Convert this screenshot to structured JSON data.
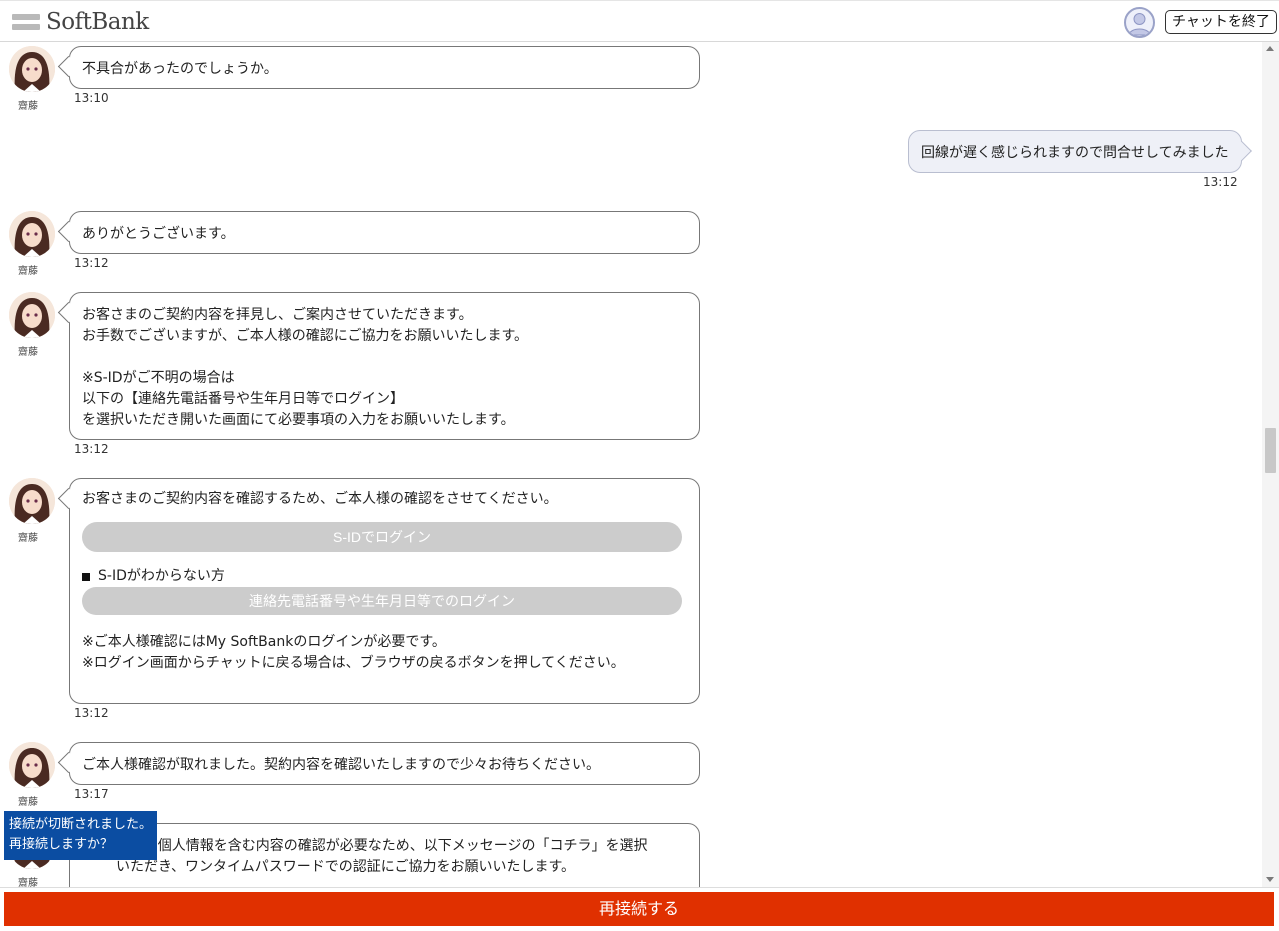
{
  "header": {
    "logo_text": "SoftBank",
    "end_chat_label": "チャットを終了"
  },
  "agent": {
    "name": "齋藤"
  },
  "messages": [
    {
      "from": "agent",
      "text": "不具合があったのでしょうか。",
      "time": "13:10"
    },
    {
      "from": "user",
      "text": "回線が遅く感じられますので問合せしてみました",
      "time": "13:12"
    },
    {
      "from": "agent",
      "text": "ありがとうございます。",
      "time": "13:12"
    },
    {
      "from": "agent",
      "text": "お客さまのご契約内容を拝見し、ご案内させていただきます。\nお手数でございますが、ご本人様の確認にご協力をお願いいたします。\n\n※S-IDがご不明の場合は\n以下の【連絡先電話番号や生年月日等でログイン】\nを選択いただき開いた画面にて必要事項の入力をお願いいたします。",
      "time": "13:12"
    },
    {
      "from": "agent",
      "intro": "お客さまのご契約内容を確認するため、ご本人様の確認をさせてください。",
      "sid_login_label": "S-IDでログイン",
      "sid_unknown_label": "S-IDがわからない方",
      "alt_login_label": "連絡先電話番号や生年月日等でのログイン",
      "note": "※ご本人様確認にはMy SoftBankのログインが必要です。\n※ログイン画面からチャットに戻る場合は、ブラウザの戻るボタンを押してください。",
      "time": "13:12"
    },
    {
      "from": "agent",
      "text": "ご本人様確認が取れました。契約内容を確認いたしますので少々お待ちください。",
      "time": "13:17"
    },
    {
      "from": "agent",
      "text": "すが、個人情報を含む内容の確認が必要なため、以下メッセージの「コチラ」を選択\nいただき、ワンタイムパスワードでの認証にご協力をお願いいたします。"
    }
  ],
  "notice": {
    "line1": "接続が切断されました。",
    "line2": "再接続しますか？"
  },
  "reconnect_label": "再接続する",
  "colors": {
    "reconnect": "#e03000",
    "notice": "#0b4da2",
    "user_bubble": "#eef0f7",
    "disabled_button": "#cccccc"
  }
}
